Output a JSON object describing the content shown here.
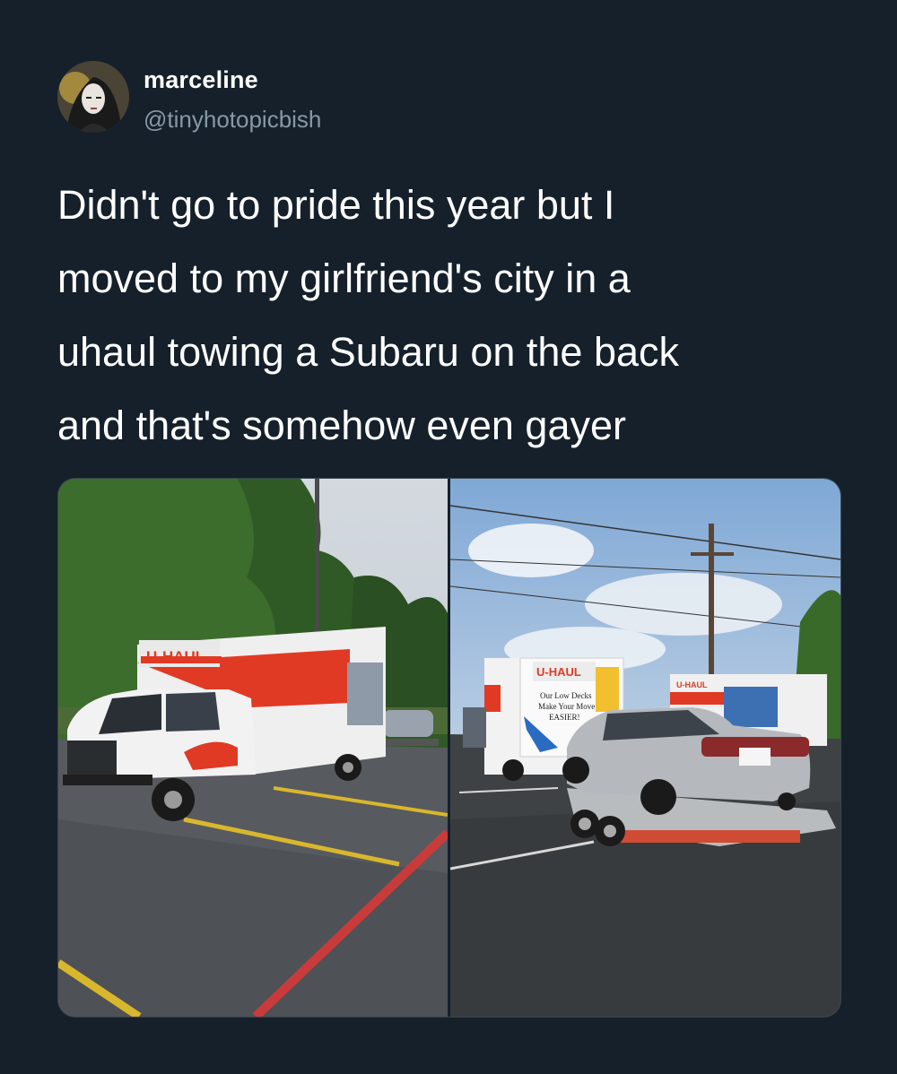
{
  "tweet": {
    "author": {
      "display_name": "marceline",
      "handle": "@tinyhotopicbish",
      "avatar_icon": "profile-photo"
    },
    "text_lines": [
      "Didn't go to pride this year but I",
      "moved to my girlfriend's city in a",
      "uhaul towing a Subaru on the back",
      "and that's somehow even gayer"
    ]
  },
  "media": {
    "photo_left": {
      "truck_logo_front": "U-HAUL",
      "truck_logo_side": "U-HAUL"
    },
    "photo_right": {
      "truck_logo_rear": "U-HAUL",
      "truck_text_rear": [
        "Our Low Decks",
        "Make Your Move",
        "EASIER!"
      ],
      "truck_logo_far": "U-HAUL"
    }
  },
  "colors": {
    "background": "#15202b",
    "secondary_text": "#8899a6",
    "uhaul_orange": "#e2401f"
  }
}
